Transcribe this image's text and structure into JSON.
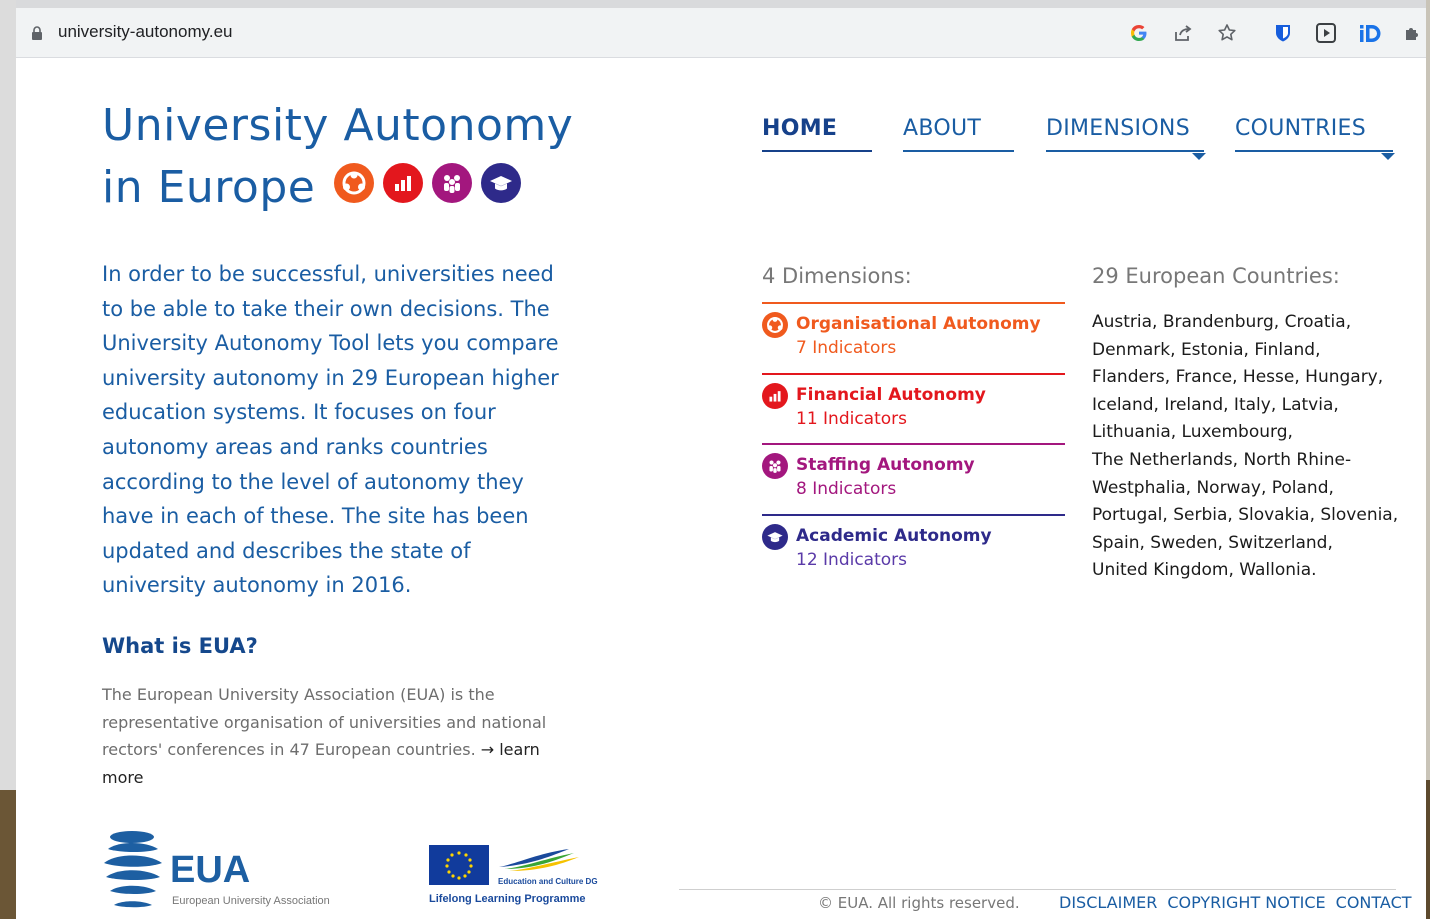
{
  "browser": {
    "url": "university-autonomy.eu"
  },
  "site": {
    "title_line1": "University Autonomy",
    "title_line2": "in Europe",
    "nav": [
      {
        "label": "HOME",
        "active": true
      },
      {
        "label": "ABOUT",
        "active": false
      },
      {
        "label": "DIMENSIONS",
        "active": false,
        "dropdown": true
      },
      {
        "label": "COUNTRIES",
        "active": false,
        "dropdown": true
      }
    ],
    "intro": "In order to be successful, universities need to be able to take their own decisions. The University Autonomy Tool lets you compare university autonomy in 29 European higher education systems. It focuses on four autonomy areas and ranks countries according to the level of autonomy they have in each of these. The site has been updated and describes the state of university autonomy in 2016.",
    "what_heading": "What is EUA?",
    "what_text": "The European University Association (EUA) is the representative organisation of universities and national rectors' conferences in 47 European countries. ",
    "learn_more": "→ learn more",
    "dimensions_heading": "4 Dimensions:",
    "dimensions": [
      {
        "name": "Organisational Autonomy",
        "count": "7 Indicators",
        "color": "#f05a1e",
        "icon": "org-network-icon"
      },
      {
        "name": "Financial Autonomy",
        "count": "11 Indicators",
        "color": "#e3171d",
        "icon": "bar-chart-icon"
      },
      {
        "name": "Staffing Autonomy",
        "count": "8 Indicators",
        "color": "#a3177e",
        "icon": "people-icon"
      },
      {
        "name": "Academic Autonomy",
        "count": "12 Indicators",
        "color": "#2e2a8a",
        "icon": "graduation-cap-icon"
      }
    ],
    "countries_heading": "29 European Countries:",
    "countries_lines": [
      "Austria, Brandenburg, Croatia,",
      "Denmark, Estonia, Finland,",
      "Flanders, France, Hesse, Hungary,",
      "Iceland, Ireland, Italy, Latvia,",
      "Lithuania, Luxembourg,",
      "The Netherlands, North Rhine-",
      "Westphalia, Norway, Poland,",
      "Portugal, Serbia, Slovakia, Slovenia,",
      "Spain, Sweden, Switzerland,",
      "United Kingdom, Wallonia."
    ],
    "footer": {
      "copyright": "© EUA. All rights reserved.",
      "links": [
        "DISCLAIMER",
        "COPYRIGHT NOTICE",
        "CONTACT"
      ]
    },
    "logos": {
      "eua_text": "EUA",
      "eua_sub": "European University Association",
      "llp_text": "Lifelong Learning Programme",
      "llp_dg": "Education and Culture DG"
    }
  },
  "colors": {
    "brand_blue": "#1a5da3",
    "org_orange": "#f05a1e",
    "fin_red": "#e3171d",
    "staff_purple": "#a3177e",
    "acad_navy": "#2e2a8a"
  }
}
